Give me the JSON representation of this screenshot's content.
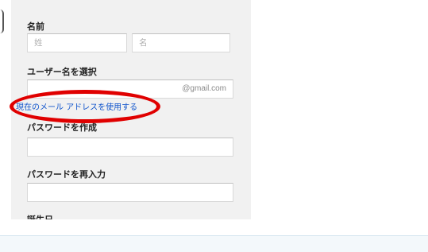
{
  "form": {
    "name_label": "名前",
    "last_name_placeholder": "姓",
    "first_name_placeholder": "名",
    "username_label": "ユーザー名を選択",
    "username_value": "",
    "username_suffix": "@gmail.com",
    "use_current_email_link": "現在のメール アドレスを使用する",
    "create_password_label": "パスワードを作成",
    "confirm_password_label": "パスワードを再入力",
    "birthday_label": "誕生日"
  },
  "annotation": {
    "highlight_color": "#e00000"
  }
}
